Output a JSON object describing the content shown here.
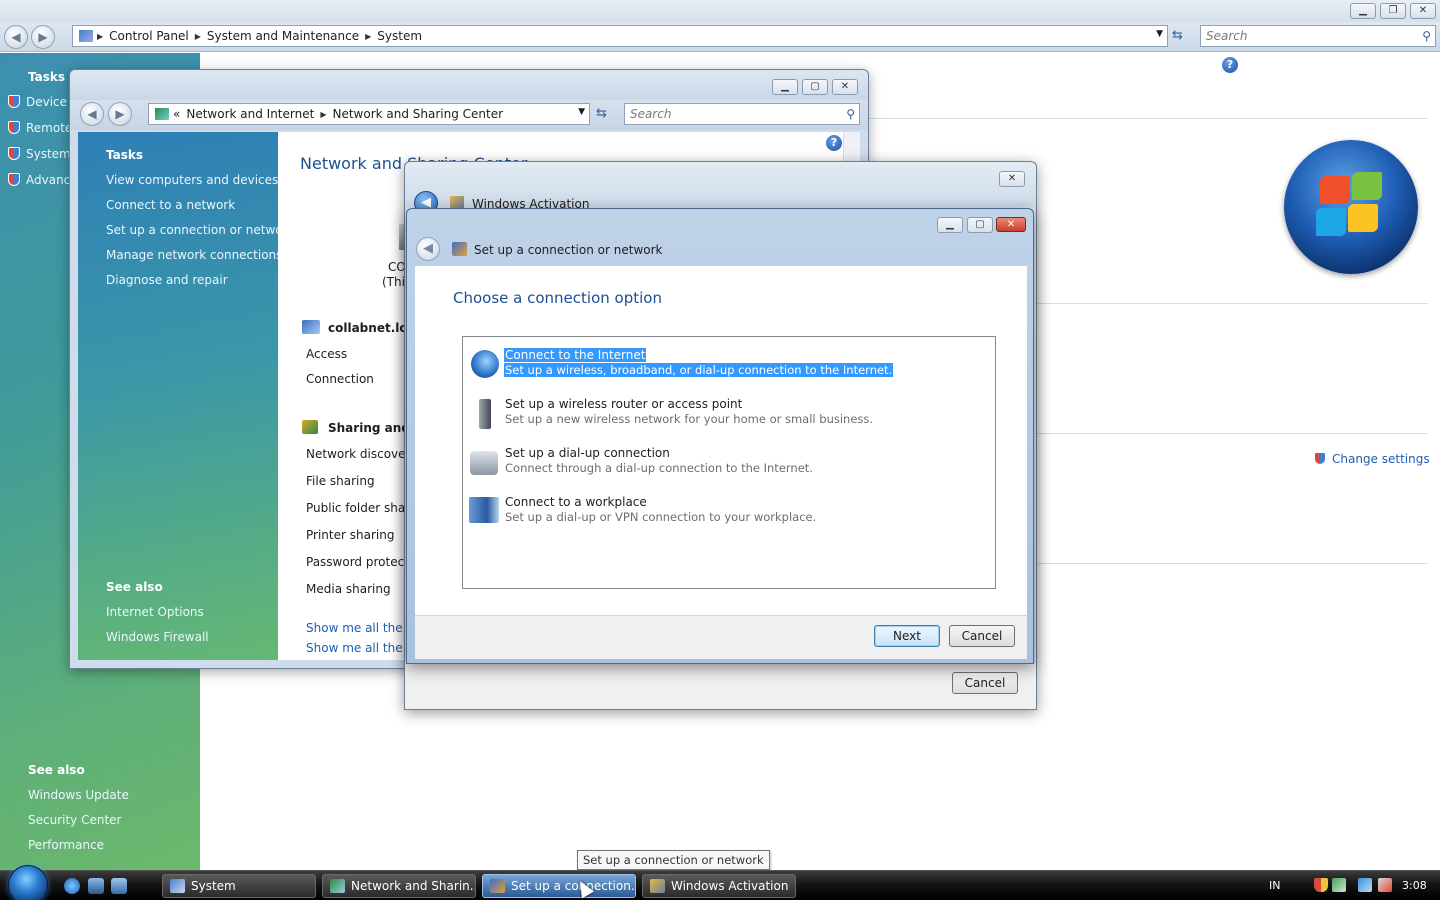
{
  "system_window": {
    "address_crumbs": [
      "Control Panel",
      "System and Maintenance",
      "System"
    ],
    "search_placeholder": "Search",
    "sidebar": {
      "tasks_title": "Tasks",
      "tasks": [
        "Device M",
        "Remote",
        "System",
        "Advanc"
      ],
      "see_also_title": "See also",
      "see_also": [
        "Windows Update",
        "Security Center",
        "Performance"
      ]
    },
    "change_settings": "Change settings"
  },
  "nsc_window": {
    "address_prefix": "«",
    "address_crumbs": [
      "Network and Internet",
      "Network and Sharing Center"
    ],
    "search_placeholder": "Search",
    "title": "Network and Sharing Center",
    "sidebar": {
      "tasks_title": "Tasks",
      "tasks": [
        "View computers and devices",
        "Connect to a network",
        "Set up a connection or network",
        "Manage network connections",
        "Diagnose and repair"
      ],
      "see_also_title": "See also",
      "see_also": [
        "Internet Options",
        "Windows Firewall"
      ]
    },
    "computer_label_line1": "CO",
    "computer_label_line2": "(This",
    "network_name": "collabnet.loca",
    "network_rows": [
      "Access",
      "Connection"
    ],
    "sharing_heading": "Sharing and D",
    "sharing_rows": [
      "Network discovery",
      "File sharing",
      "Public folder sharin",
      "Printer sharing",
      "Password protecte",
      "Media sharing"
    ],
    "footer_links": [
      "Show me all the file",
      "Show me all the sh"
    ]
  },
  "activation_window": {
    "title": "Windows Activation",
    "cancel": "Cancel"
  },
  "connection_window": {
    "title": "Set up a connection or network",
    "heading": "Choose a connection option",
    "options": [
      {
        "title": "Connect to the Internet",
        "desc": "Set up a wireless, broadband, or dial-up connection to the Internet.",
        "icon": "globe-icon",
        "selected": true
      },
      {
        "title": "Set up a wireless router or access point",
        "desc": "Set up a new wireless network for your home or small business.",
        "icon": "router-icon",
        "selected": false
      },
      {
        "title": "Set up a dial-up connection",
        "desc": "Connect through a dial-up connection to the Internet.",
        "icon": "phone-icon",
        "selected": false
      },
      {
        "title": "Connect to a workplace",
        "desc": "Set up a dial-up or VPN connection to your workplace.",
        "icon": "workplace-icon",
        "selected": false
      }
    ],
    "next": "Next",
    "cancel": "Cancel"
  },
  "tooltip": "Set up a connection or network",
  "taskbar": {
    "buttons": [
      {
        "label": "System",
        "active": false
      },
      {
        "label": "Network and Sharin...",
        "active": false
      },
      {
        "label": "Set up a connection...",
        "active": true
      },
      {
        "label": "Windows Activation",
        "active": false
      }
    ],
    "language": "IN",
    "clock": "3:08"
  },
  "colors": {
    "selection": "#3399ff",
    "link": "#1c5fb0",
    "heading": "#1d4f91"
  }
}
